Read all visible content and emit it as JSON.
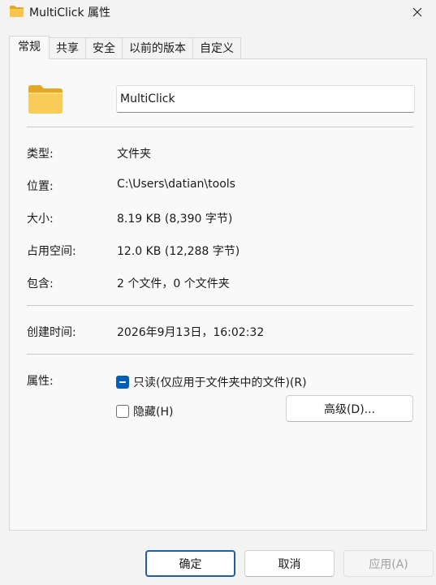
{
  "window": {
    "title": "MultiClick 属性",
    "title_icon": "folder-icon",
    "close_icon": "close-icon"
  },
  "tabs": [
    {
      "label": "常规",
      "active": true
    },
    {
      "label": "共享",
      "active": false
    },
    {
      "label": "安全",
      "active": false
    },
    {
      "label": "以前的版本",
      "active": false
    },
    {
      "label": "自定义",
      "active": false
    }
  ],
  "general": {
    "folder_icon": "folder-icon",
    "name_value": "MultiClick",
    "properties": [
      {
        "label": "类型:",
        "value": "文件夹"
      },
      {
        "label": "位置:",
        "value": "C:\\Users\\datian\\tools"
      },
      {
        "label": "大小:",
        "value": "8.19 KB (8,390 字节)"
      },
      {
        "label": "占用空间:",
        "value": "12.0 KB (12,288 字节)"
      },
      {
        "label": "包含:",
        "value": "2 个文件，0 个文件夹"
      }
    ],
    "created": {
      "label": "创建时间:",
      "value": "2026年9月13日，16:02:32"
    },
    "attributes": {
      "label": "属性:",
      "readonly": {
        "label": "只读(仅应用于文件夹中的文件)(R)",
        "state": "indeterminate"
      },
      "hidden": {
        "label": "隐藏(H)",
        "state": "unchecked"
      },
      "advanced_label": "高级(D)..."
    }
  },
  "footer": {
    "ok_label": "确定",
    "cancel_label": "取消",
    "apply_label": "应用(A)",
    "apply_enabled": false
  },
  "colors": {
    "accent": "#005fb8",
    "folder": "#f3c14e"
  }
}
